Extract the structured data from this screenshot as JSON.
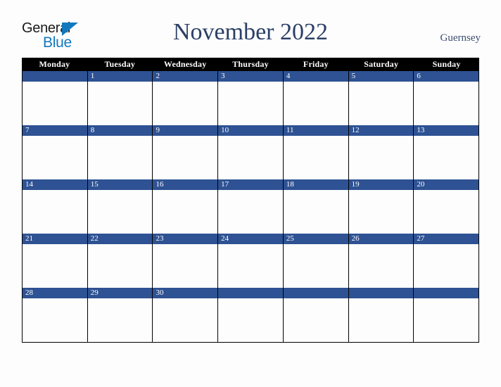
{
  "brand": {
    "name_part1": "General",
    "name_part2": "Blue",
    "triangle_icon": "triangle-right-icon",
    "accent_color": "#1278be"
  },
  "header": {
    "title": "November 2022",
    "locale": "Guernsey",
    "title_color": "#2b3f66"
  },
  "calendar": {
    "month": "November",
    "year": "2022",
    "header_bg": "#000000",
    "day_bar_color": "#2e5293",
    "grid_line_color": "#000000",
    "cell_bg": "#fdfdfd",
    "weekday_headers": [
      "Monday",
      "Tuesday",
      "Wednesday",
      "Thursday",
      "Friday",
      "Saturday",
      "Sunday"
    ],
    "weeks": [
      [
        "",
        "1",
        "2",
        "3",
        "4",
        "5",
        "6"
      ],
      [
        "7",
        "8",
        "9",
        "10",
        "11",
        "12",
        "13"
      ],
      [
        "14",
        "15",
        "16",
        "17",
        "18",
        "19",
        "20"
      ],
      [
        "21",
        "22",
        "23",
        "24",
        "25",
        "26",
        "27"
      ],
      [
        "28",
        "29",
        "30",
        "",
        "",
        "",
        ""
      ]
    ]
  }
}
